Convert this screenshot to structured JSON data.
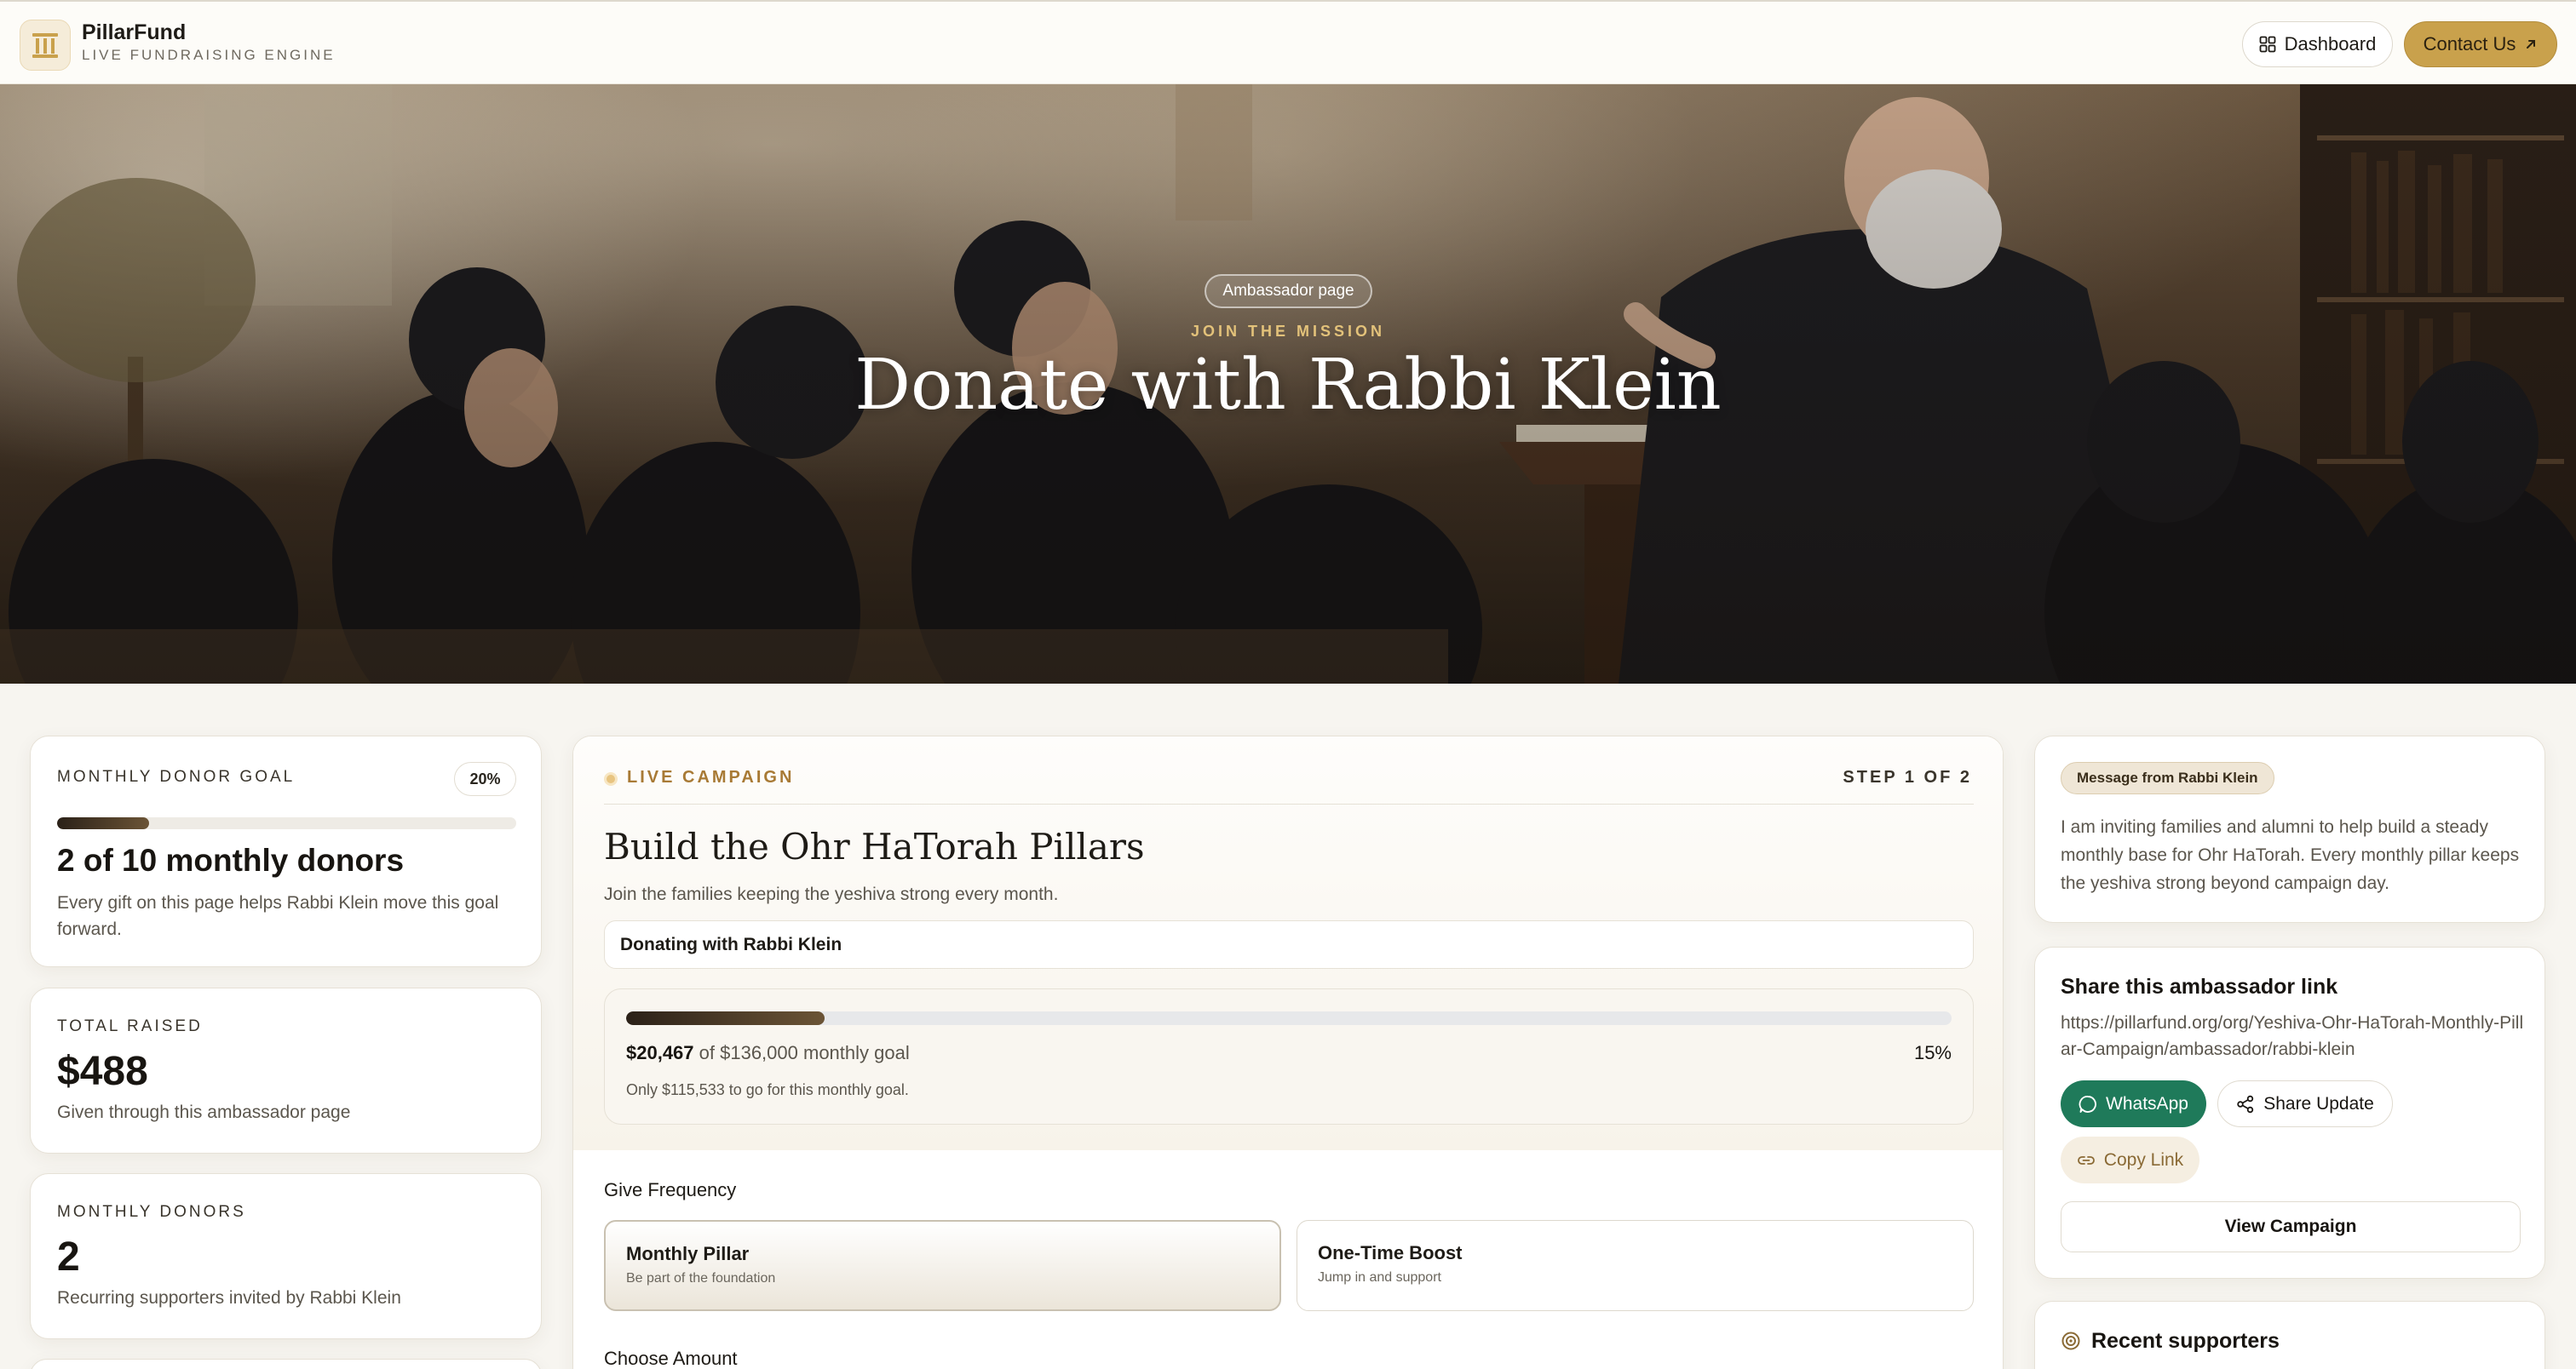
{
  "brand": {
    "name": "PillarFund",
    "tagline": "LIVE FUNDRAISING ENGINE"
  },
  "nav": {
    "dashboard_label": "Dashboard",
    "contact_label": "Contact Us"
  },
  "hero": {
    "badge": "Ambassador page",
    "kicker": "JOIN THE MISSION",
    "title": "Donate with Rabbi Klein"
  },
  "goal": {
    "label": "MONTHLY DONOR GOAL",
    "percent_label": "20%",
    "progress_fraction": 0.2,
    "headline": "2 of 10 monthly donors",
    "description": "Every gift on this page helps Rabbi Klein move this goal forward."
  },
  "stats": {
    "raised_label": "TOTAL RAISED",
    "raised_value": "$488",
    "raised_sub": "Given through this ambassador page",
    "donors_label": "MONTHLY DONORS",
    "donors_value": "2",
    "donors_sub": "Recurring supporters invited by Rabbi Klein"
  },
  "campaign": {
    "live_label": "LIVE CAMPAIGN",
    "step_label": "STEP 1 OF 2",
    "title": "Build the Ohr HaTorah Pillars",
    "subtitle": "Join the families keeping the yeshiva strong every month.",
    "donating_with": "Donating with Rabbi Klein",
    "raised": "$20,467",
    "goal_text": "of $136,000 monthly goal",
    "percent_label": "15%",
    "progress_fraction": 0.15,
    "remaining_note": "Only $115,533 to go for this monthly goal.",
    "frequency_label": "Give Frequency",
    "frequency_options": [
      {
        "title": "Monthly Pillar",
        "desc": "Be part of the foundation",
        "selected": true
      },
      {
        "title": "One-Time Boost",
        "desc": "Jump in and support",
        "selected": false
      }
    ],
    "amount_label": "Choose Amount"
  },
  "message": {
    "pill": "Message from Rabbi Klein",
    "text": "I am inviting families and alumni to help build a steady monthly base for Ohr HaTorah. Every monthly pillar keeps the yeshiva strong beyond campaign day."
  },
  "share": {
    "title": "Share this ambassador link",
    "url": "https://pillarfund.org/org/Yeshiva-Ohr-HaTorah-Monthly-Pillar-Campaign/ambassador/rabbi-klein",
    "whatsapp_label": "WhatsApp",
    "share_update_label": "Share Update",
    "copy_label": "Copy Link",
    "view_label": "View Campaign"
  },
  "recent": {
    "title": "Recent supporters"
  },
  "colors": {
    "accent_gold": "#c9a14c",
    "whatsapp_green": "#1f7a5a",
    "progress_dark": "#2b2118"
  }
}
